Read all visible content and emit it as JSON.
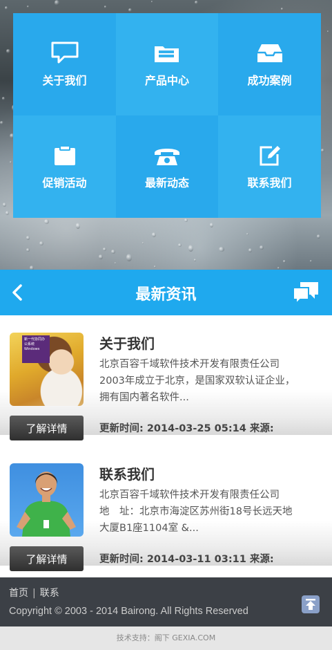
{
  "menu": [
    {
      "label": "关于我们",
      "icon": "speech-bubble-icon"
    },
    {
      "label": "产品中心",
      "icon": "folder-icon"
    },
    {
      "label": "成功案例",
      "icon": "inbox-tray-icon"
    },
    {
      "label": "促销活动",
      "icon": "clipboard-icon"
    },
    {
      "label": "最新动态",
      "icon": "telephone-icon"
    },
    {
      "label": "联系我们",
      "icon": "edit-icon"
    }
  ],
  "header": {
    "title": "最新资讯",
    "back_icon": "chevron-left-icon",
    "right_icon": "chat-bubbles-icon"
  },
  "news": [
    {
      "title": "关于我们",
      "desc_lines": [
        "北京百容千域软件技术开发有限责任公司",
        "2003年成立于北京，是国家双软认证企业，",
        "拥有国内著名软件..."
      ],
      "button": "了解详情",
      "meta": "更新时间: 2014-03-25 05:14 来源:",
      "thumb_caption": "新一代协同办公系统",
      "thumb_subcaption": "Windows"
    },
    {
      "title": "联系我们",
      "desc_lines": [
        "北京百容千域软件技术开发有限责任公司",
        "地　址：北京市海淀区苏州街18号长远天地",
        "大厦B1座1104室 &..."
      ],
      "button": "了解详情",
      "meta": "更新时间: 2014-03-11 03:11 来源:"
    }
  ],
  "footer": {
    "links": [
      "首页",
      "联系"
    ],
    "separator": "|",
    "copyright": "Copyright © 2003 - 2014 Bairong. All Rights Reserved",
    "support": "技术支持：阁下 GEXIA.COM"
  },
  "colors": {
    "accent": "#1fa9ee",
    "tile_dark": "#29a9ec",
    "tile_light": "#33b2ef",
    "footer": "#3c4046"
  }
}
